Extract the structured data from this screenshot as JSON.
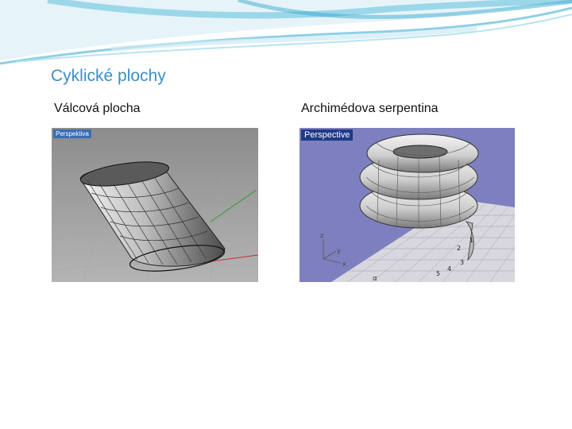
{
  "title": "Cyklické plochy",
  "left": {
    "label": "Válcová plocha",
    "viewport_tag": "Perspektiva"
  },
  "right": {
    "label": "Archimédova serpentina",
    "viewport_tag": "Perspective",
    "axis_labels": {
      "z": "z",
      "y": "y",
      "x": "x"
    },
    "annotations": [
      "α",
      "1",
      "2",
      "3",
      "4",
      "5"
    ]
  },
  "colors": {
    "title": "#3d8fc2",
    "banner": "#6fc6e0",
    "left_viewport_bg": "#9b9b9b",
    "right_viewport_bg": "#7d7fbe"
  }
}
